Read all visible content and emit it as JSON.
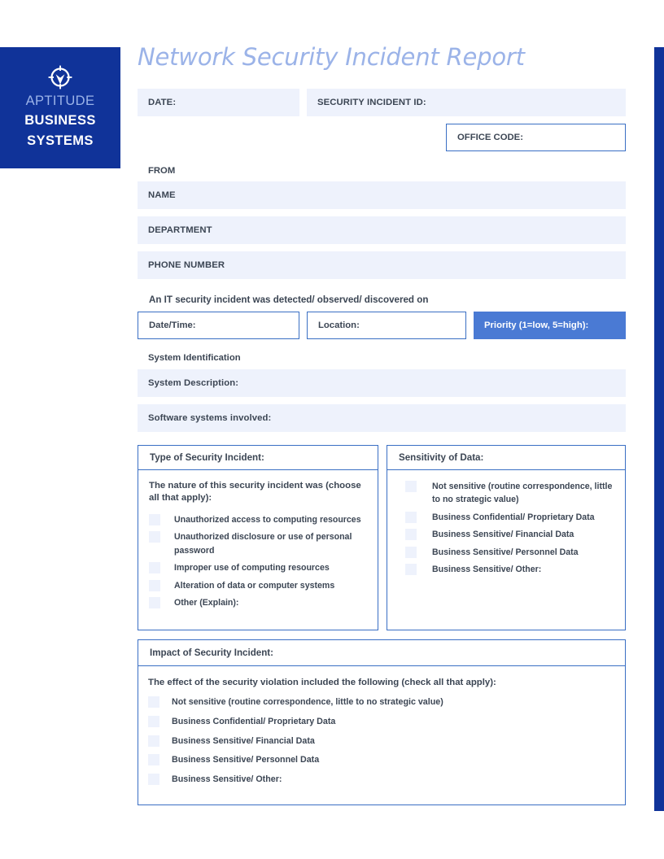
{
  "brand": {
    "logo_icon": "crosshair-target-icon",
    "line1": "APTITUDE",
    "line2": "BUSINESS",
    "line3": "SYSTEMS",
    "bg_color": "#103399",
    "accent_color": "#9bb3e8"
  },
  "document": {
    "title": "Network Security Incident Report"
  },
  "top_fields": {
    "date_label": "DATE:",
    "incident_id_label": "SECURITY INCIDENT ID:",
    "office_code_label": "OFFICE CODE:"
  },
  "from_section": {
    "heading": "FROM",
    "fields": [
      {
        "label": "NAME"
      },
      {
        "label": "DEPARTMENT"
      },
      {
        "label": "PHONE NUMBER"
      }
    ]
  },
  "detection": {
    "intro": "An IT security incident was detected/ observed/ discovered on",
    "datetime_label": "Date/Time:",
    "location_label": "Location:",
    "priority_label": "Priority (1=low, 5=high):",
    "priority_bg": "#4a7ad4"
  },
  "system_identification": {
    "heading": "System Identification",
    "fields": [
      {
        "label": "System Description:"
      },
      {
        "label": "Software systems involved:"
      }
    ]
  },
  "type_panel": {
    "header": "Type of Security Incident:",
    "intro": "The nature of this security incident was (choose all that apply):",
    "options": [
      {
        "label": "Unauthorized access to computing resources",
        "checked": false
      },
      {
        "label": "Unauthorized disclosure or use of personal password",
        "checked": false
      },
      {
        "label": "Improper use of computing resources",
        "checked": false
      },
      {
        "label": "Alteration of data or computer systems",
        "checked": false
      },
      {
        "label": "Other (Explain):",
        "checked": false
      }
    ]
  },
  "sensitivity_panel": {
    "header": "Sensitivity of Data:",
    "options": [
      {
        "label": "Not sensitive (routine correspondence, little to no strategic value)",
        "checked": false
      },
      {
        "label": "Business Confidential/ Proprietary Data",
        "checked": false
      },
      {
        "label": "Business Sensitive/ Financial Data",
        "checked": false
      },
      {
        "label": "Business Sensitive/ Personnel Data",
        "checked": false
      },
      {
        "label": "Business Sensitive/ Other:",
        "checked": false
      }
    ]
  },
  "impact_panel": {
    "header": "Impact of Security Incident:",
    "intro": "The effect of the security violation included the following (check all that apply):",
    "options": [
      {
        "label": "Not sensitive (routine correspondence, little to no strategic value)",
        "checked": false
      },
      {
        "label": "Business Confidential/ Proprietary Data",
        "checked": false
      },
      {
        "label": "Business Sensitive/ Financial Data",
        "checked": false
      },
      {
        "label": "Business Sensitive/ Personnel Data",
        "checked": false
      },
      {
        "label": "Business Sensitive/ Other:",
        "checked": false
      }
    ]
  },
  "theme": {
    "field_fill": "#eef2fc",
    "border_blue": "#3a6fc4",
    "text_color": "#3c4654"
  }
}
